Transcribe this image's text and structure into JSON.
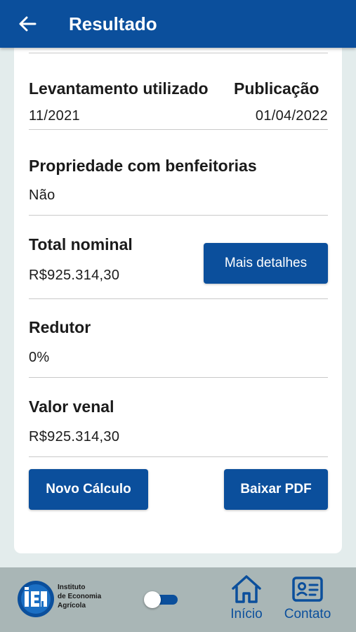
{
  "header": {
    "title": "Resultado",
    "back_icon": "arrow-left-icon"
  },
  "result": {
    "levantamento_label": "Levantamento utilizado",
    "levantamento_value": "11/2021",
    "publicacao_label": "Publicação",
    "publicacao_value": "01/04/2022",
    "propriedade_label": "Propriedade com benfeitorias",
    "propriedade_value": "Não",
    "total_label": "Total nominal",
    "total_value": "R$925.314,30",
    "details_button": "Mais detalhes",
    "redutor_label": "Redutor",
    "redutor_value": "0%",
    "venal_label": "Valor venal",
    "venal_value": "R$925.314,30"
  },
  "actions": {
    "novo_calculo": "Novo Cálculo",
    "baixar_pdf": "Baixar PDF"
  },
  "footer": {
    "logo_text_line1": "Instituto",
    "logo_text_line2": "de Economia",
    "logo_text_line3": "Agrícola",
    "toggle_on": true,
    "nav_inicio": "Início",
    "nav_contato": "Contato",
    "nav_inicio_icon": "home-icon",
    "nav_contato_icon": "contact-card-icon"
  },
  "colors": {
    "primary": "#0b4f9c",
    "background": "#e3ecec",
    "footer": "#a9b6b6"
  }
}
